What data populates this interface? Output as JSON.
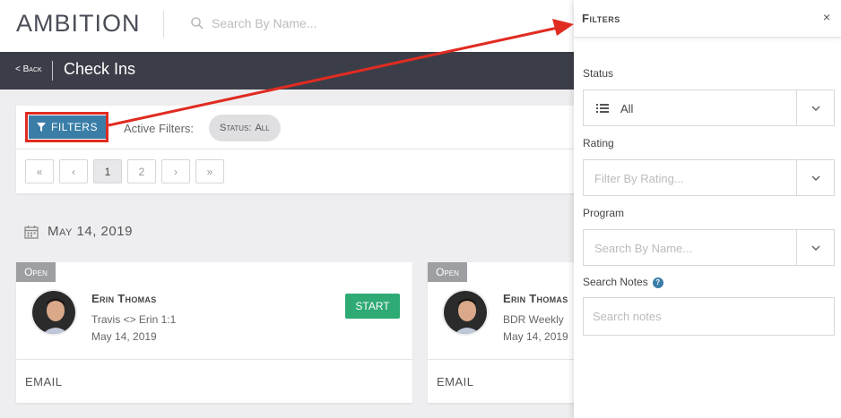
{
  "app": {
    "logo_text": "AMBITION"
  },
  "topbar": {
    "search_placeholder": "Search By Name..."
  },
  "subheader": {
    "back_label": "< Back",
    "title": "Check Ins"
  },
  "filter_bar": {
    "filters_button_label": "FILTERS",
    "active_filters_label": "Active Filters:",
    "chip_key": "Status:",
    "chip_value": "All"
  },
  "pagination": {
    "first": "«",
    "prev": "‹",
    "pages": [
      "1",
      "2"
    ],
    "next": "›",
    "last": "»",
    "active_page": "1"
  },
  "date_heading": "May 14, 2019",
  "cards": [
    {
      "status": "Open",
      "name": "Erin Thomas",
      "meeting": "Travis <> Erin 1:1",
      "date": "May 14, 2019",
      "action": "START",
      "footer": "EMAIL"
    },
    {
      "status": "Open",
      "name": "Erin Thomas",
      "meeting": "BDR Weekly",
      "date": "May 14, 2019",
      "footer": "EMAIL"
    }
  ],
  "drawer": {
    "title": "Filters",
    "close": "×",
    "status_label": "Status",
    "status_value": "All",
    "rating_label": "Rating",
    "rating_placeholder": "Filter By Rating...",
    "program_label": "Program",
    "program_placeholder": "Search By Name...",
    "notes_label": "Search Notes",
    "notes_help": "?",
    "notes_placeholder": "Search notes"
  },
  "colors": {
    "accent_blue": "#3a7ea8",
    "start_green": "#2eaa74",
    "annotation_red": "#e02b21",
    "subheader_bg": "#3b3e48"
  },
  "icons": [
    "search-icon",
    "filter-icon",
    "calendar-icon",
    "list-icon",
    "chevron-down-icon",
    "close-icon",
    "help-icon"
  ]
}
